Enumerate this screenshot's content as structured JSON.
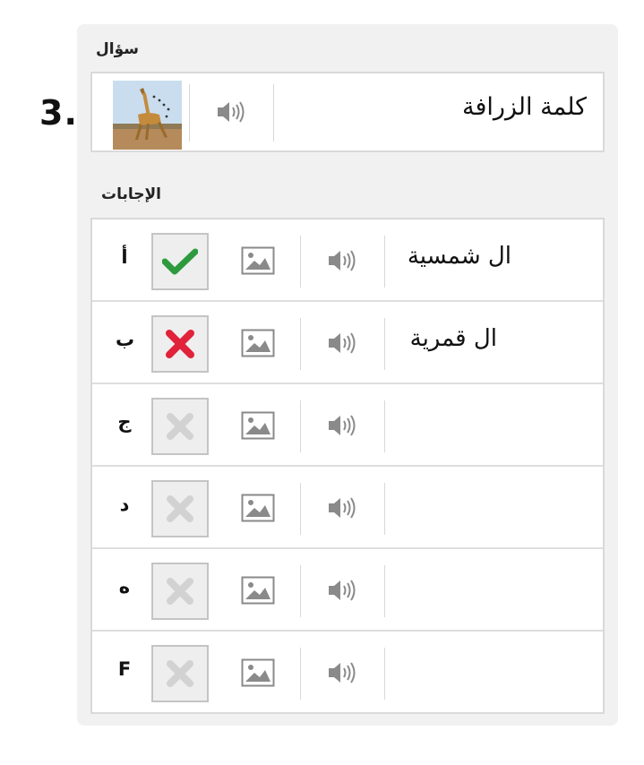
{
  "question": {
    "number": "3.",
    "section_label": "سؤال",
    "text": "كلمة الزرافة"
  },
  "answers_label": "الإجابات",
  "answers": [
    {
      "letter": "أ",
      "text": "ال شمسية",
      "state": "correct"
    },
    {
      "letter": "ب",
      "text": "ال قمرية",
      "state": "wrong"
    },
    {
      "letter": "ج",
      "text": "",
      "state": "empty"
    },
    {
      "letter": "د",
      "text": "",
      "state": "empty"
    },
    {
      "letter": "ه",
      "text": "",
      "state": "empty"
    },
    {
      "letter": "F",
      "text": "",
      "state": "empty"
    }
  ],
  "colors": {
    "correct": "#2e9a3e",
    "wrong": "#e0223a",
    "inactive": "#d2d2d2",
    "icon": "#8a8a8a"
  },
  "icons": {
    "audio": "speaker-icon",
    "image": "image-icon",
    "correct": "check-icon",
    "wrong": "x-icon"
  }
}
